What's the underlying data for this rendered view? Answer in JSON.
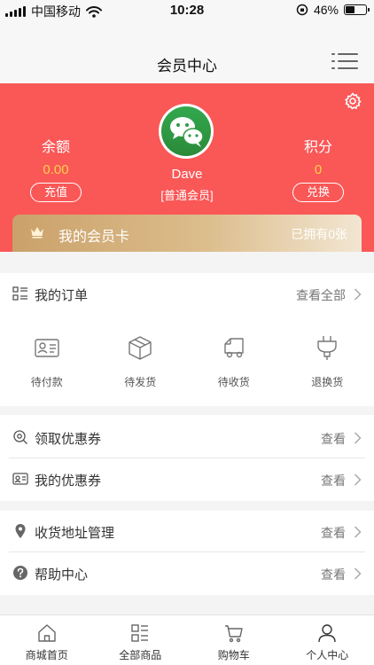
{
  "status_bar": {
    "carrier": "中国移动",
    "time": "10:28",
    "battery": "46%",
    "battery_level": 0.46
  },
  "nav": {
    "title": "会员中心"
  },
  "member": {
    "username": "Dave",
    "level": "[普通会员]",
    "balance": {
      "label": "余额",
      "value": "0.00",
      "button": "充值"
    },
    "points": {
      "label": "积分",
      "value": "0",
      "button": "兑换"
    },
    "card": {
      "label": "我的会员卡",
      "owned": "已拥有0张"
    },
    "colors": {
      "header": "#fa5757",
      "value": "#ffd24a"
    }
  },
  "orders": {
    "title": "我的订单",
    "view_all": "查看全部",
    "items": [
      {
        "label": "待付款",
        "icon": "wallet-card-icon"
      },
      {
        "label": "待发货",
        "icon": "box-icon"
      },
      {
        "label": "待收货",
        "icon": "truck-icon"
      },
      {
        "label": "退换货",
        "icon": "plug-icon"
      }
    ]
  },
  "coupons": {
    "get": {
      "label": "领取优惠券",
      "action": "查看"
    },
    "mine": {
      "label": "我的优惠券",
      "action": "查看"
    }
  },
  "services": {
    "address": {
      "label": "收货地址管理",
      "action": "查看"
    },
    "help": {
      "label": "帮助中心",
      "action": "查看"
    }
  },
  "tabbar": {
    "tabs": [
      {
        "label": "商城首页",
        "icon": "home-icon"
      },
      {
        "label": "全部商品",
        "icon": "grid-list-icon"
      },
      {
        "label": "购物车",
        "icon": "cart-icon"
      },
      {
        "label": "个人中心",
        "icon": "person-icon"
      }
    ]
  }
}
